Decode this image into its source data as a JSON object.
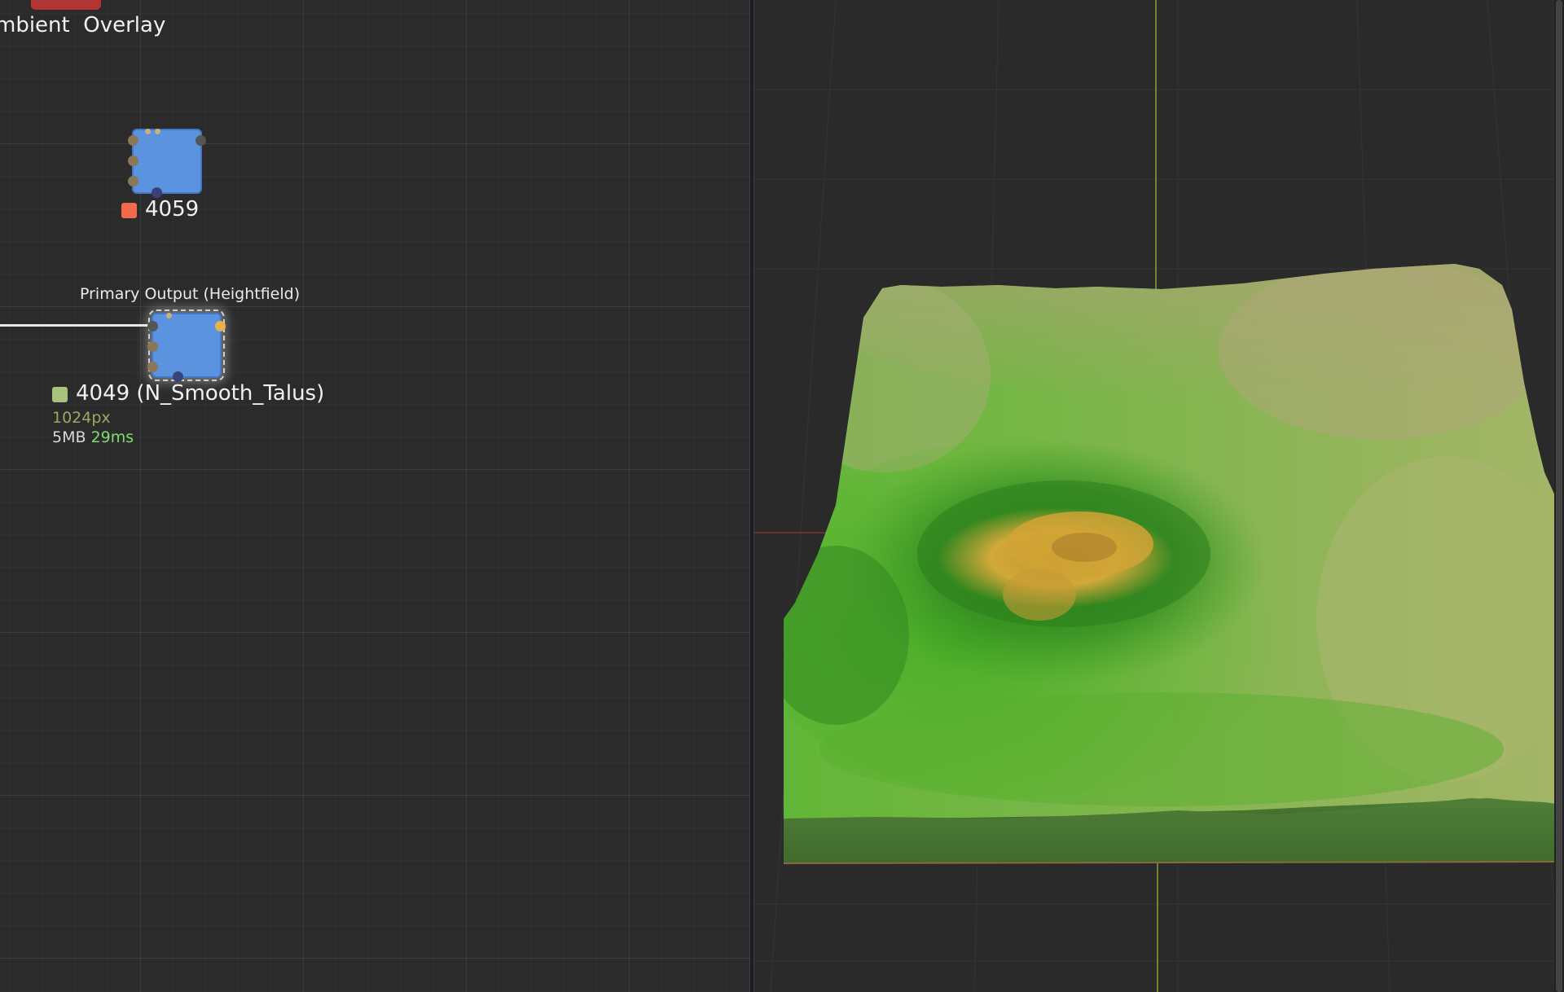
{
  "graph": {
    "top_node": {
      "label_prefix": "mbient",
      "label_suffix": "Overlay",
      "color": "#b23535"
    },
    "node_4059": {
      "id_label": "4059",
      "status_color": "#f26a4b"
    },
    "primary_node": {
      "caption": "Primary Output (Heightfield)",
      "id_label": "4049 (N_Smooth_Talus)",
      "status_color": "#a7c27c",
      "resolution": "1024px",
      "memory": "5MB",
      "time": "29ms",
      "resolution_color": "#9ea663",
      "time_color": "#7fdc6f"
    }
  },
  "viewport": {
    "background": "#2a2a2a",
    "axis_green": "#6f8a2a",
    "axis_red": "#7a3535",
    "terrain_colors": [
      "#2c7e1c",
      "#56b82c",
      "#a9b56a",
      "#d2a83a"
    ]
  }
}
